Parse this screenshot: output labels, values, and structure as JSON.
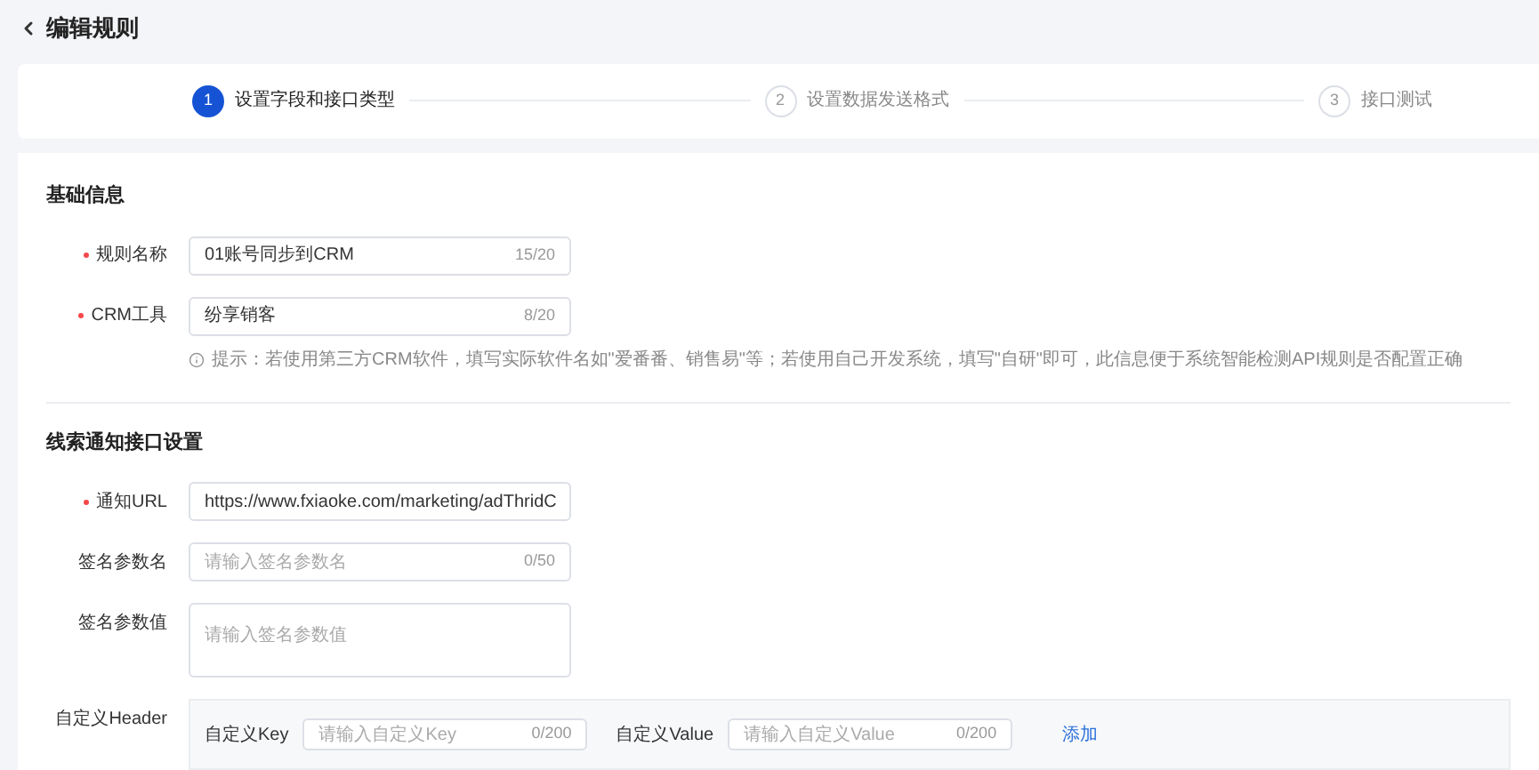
{
  "page_title": "编辑规则",
  "steps": [
    {
      "number": "1",
      "label": "设置字段和接口类型",
      "selected": true
    },
    {
      "number": "2",
      "label": "设置数据发送格式",
      "selected": false
    },
    {
      "number": "3",
      "label": "接口测试",
      "selected": false
    }
  ],
  "sections": [
    {
      "title": "基础信息",
      "fields": [
        {
          "kind": "input",
          "label": "规则名称",
          "required": true,
          "value": "01账号同步到CRM",
          "counter": "15/20"
        },
        {
          "kind": "input",
          "label": "CRM工具",
          "required": true,
          "value": "纷享销客",
          "counter": "8/20",
          "hint": "提示：若使用第三方CRM软件，填写实际软件名如\"爱番番、销售易\"等；若使用自己开发系统，填写\"自研\"即可，此信息便于系统智能检测API规则是否配置正确"
        }
      ]
    },
    {
      "title": "线索通知接口设置",
      "fields": [
        {
          "kind": "input",
          "label": "通知URL",
          "required": true,
          "value": "https://www.fxiaoke.com/marketing/adThridC"
        },
        {
          "kind": "input",
          "label": "签名参数名",
          "required": false,
          "placeholder": "请输入签名参数名",
          "counter": "0/50"
        },
        {
          "kind": "textarea",
          "label": "签名参数值",
          "required": false,
          "placeholder": "请输入签名参数值"
        },
        {
          "kind": "header",
          "label": "自定义Header",
          "required": false,
          "key_label": "自定义Key",
          "key_placeholder": "请输入自定义Key",
          "key_counter": "0/200",
          "value_label": "自定义Value",
          "value_placeholder": "请输入自定义Value",
          "value_counter": "0/200",
          "add_link": "添加"
        }
      ]
    }
  ]
}
